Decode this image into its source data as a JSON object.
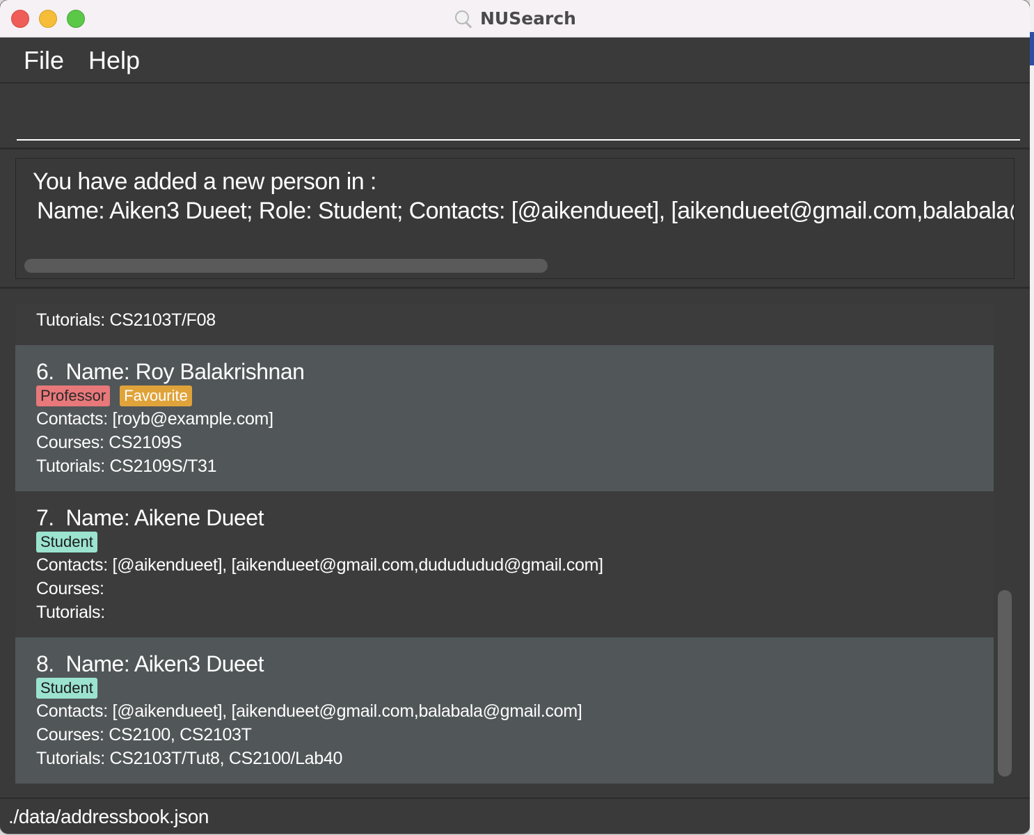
{
  "window": {
    "title": "NUSearch"
  },
  "menu": {
    "file": "File",
    "help": "Help"
  },
  "command": {
    "value": ""
  },
  "result": {
    "line1": "You have added a new person in :",
    "line2": "Name: Aiken3 Dueet; Role: Student; Contacts: [@aikendueet], [aikendueet@gmail.com,balabala@"
  },
  "list": {
    "partial": {
      "tutorials": "Tutorials: CS2103T/F08"
    },
    "cards": [
      {
        "index": "6.",
        "name": "Name: Roy Balakrishnan",
        "tags": [
          "Professor",
          "Favourite"
        ],
        "contacts": "Contacts: [royb@example.com]",
        "courses": "Courses: CS2109S",
        "tutorials": "Tutorials: CS2109S/T31"
      },
      {
        "index": "7.",
        "name": "Name: Aikene Dueet",
        "tags": [
          "Student"
        ],
        "contacts": "Contacts: [@aikendueet], [aikendueet@gmail.com,dudududud@gmail.com]",
        "courses": "Courses:",
        "tutorials": "Tutorials:"
      },
      {
        "index": "8.",
        "name": "Name: Aiken3 Dueet",
        "tags": [
          "Student"
        ],
        "contacts": "Contacts: [@aikendueet], [aikendueet@gmail.com,balabala@gmail.com]",
        "courses": "Courses: CS2100, CS2103T",
        "tutorials": "Tutorials: CS2103T/Tut8, CS2100/Lab40"
      }
    ]
  },
  "status": {
    "file_path": "./data/addressbook.json"
  },
  "colors": {
    "professor_tag": "#e8787a",
    "favourite_tag": "#e0a33a",
    "student_tag": "#9be3cf",
    "background": "#3a3a3a"
  },
  "icons": {
    "app": "magnifier-icon"
  }
}
